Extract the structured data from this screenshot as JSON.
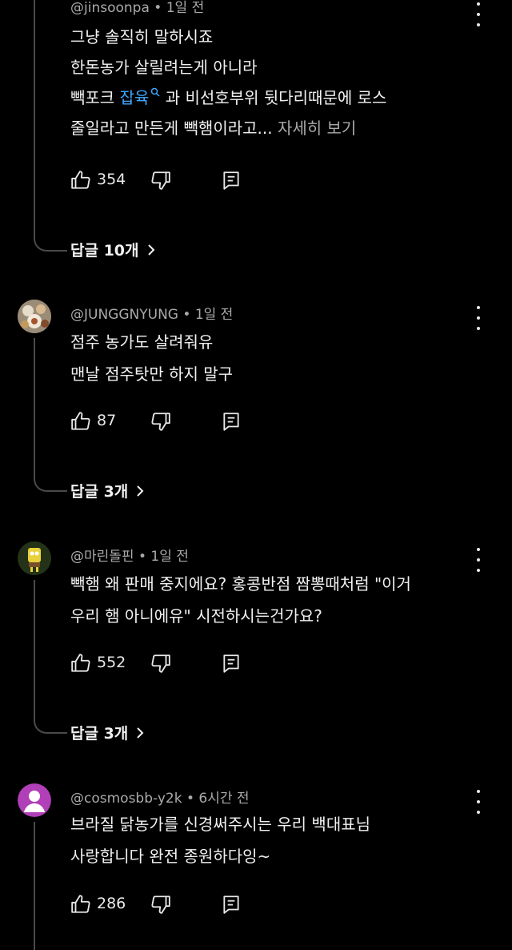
{
  "comments": [
    {
      "handle": "@jinsoonpa",
      "time": "1일 전",
      "lines": [
        "그냥 솔직히 말하시죠",
        "한돈농가 살릴려는게 아니라"
      ],
      "line3_pre": "빽포크 ",
      "line3_link": "잡육",
      "line3_post": " 과 비선호부위 뒷다리때문에 로스",
      "line4": "줄일라고 만든게 빽햄이라고...",
      "more_label": "자세히 보기",
      "likes": "354",
      "replies_label": "답글 10개"
    },
    {
      "handle": "@JUNGGNYUNG",
      "time": "1일 전",
      "lines": [
        "점주 농가도 살려줘유",
        "맨날 점주탓만 하지 말구"
      ],
      "likes": "87",
      "replies_label": "답글 3개"
    },
    {
      "handle": "@마린돌핀",
      "time": "1일 전",
      "lines": [
        "빽햄 왜 판매 중지에요? 홍콩반점 짬뽕때처럼 \"이거",
        "우리 햄 아니에유\" 시전하시는건가요?"
      ],
      "likes": "552",
      "replies_label": "답글 3개"
    },
    {
      "handle": "@cosmosbb-y2k",
      "time": "6시간 전",
      "lines": [
        "브라질 닭농가를 신경써주시는 우리 백대표님",
        "사랑합니다 완전 종원하다잉~"
      ],
      "likes": "286"
    }
  ],
  "separator": " • ",
  "colors": {
    "link": "#3ea6ff",
    "meta": "#aaaaaa",
    "avatar4": "#b03fb8"
  },
  "icons": [
    "thumbs-up-icon",
    "thumbs-down-icon",
    "reply-icon",
    "more-vert-icon",
    "chevron-right-icon",
    "search-icon"
  ]
}
